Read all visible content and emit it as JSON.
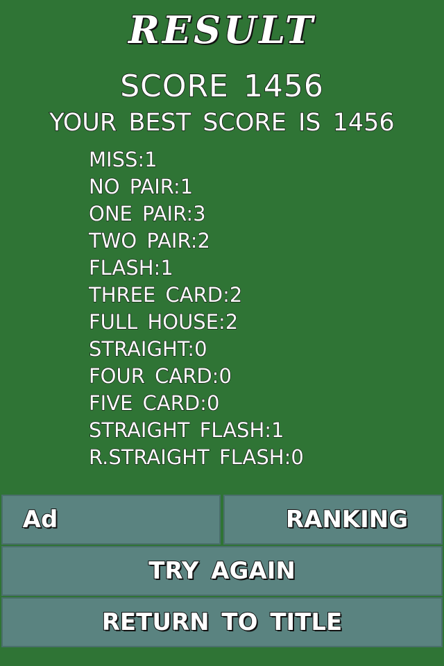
{
  "title": "RESULT",
  "score_line": "SCORE 1456",
  "best_line": "YOUR BEST SCORE IS 1456",
  "stats": [
    "MISS:1",
    "NO PAIR:1",
    "ONE PAIR:3",
    "TWO PAIR:2",
    "FLASH:1",
    "THREE CARD:2",
    "FULL HOUSE:2",
    "STRAIGHT:0",
    "FOUR CARD:0",
    "FIVE CARD:0",
    "STRAIGHT FLASH:1",
    "R.STRAIGHT FLASH:0"
  ],
  "buttons": {
    "ad": "Ad",
    "ranking": "RANKING",
    "try_again": "TRY AGAIN",
    "return_to_title": "RETURN TO TITLE"
  },
  "colors": {
    "background": "#2f7435",
    "button": "#5a8380",
    "text": "#ffffff",
    "outline": "#111111"
  }
}
